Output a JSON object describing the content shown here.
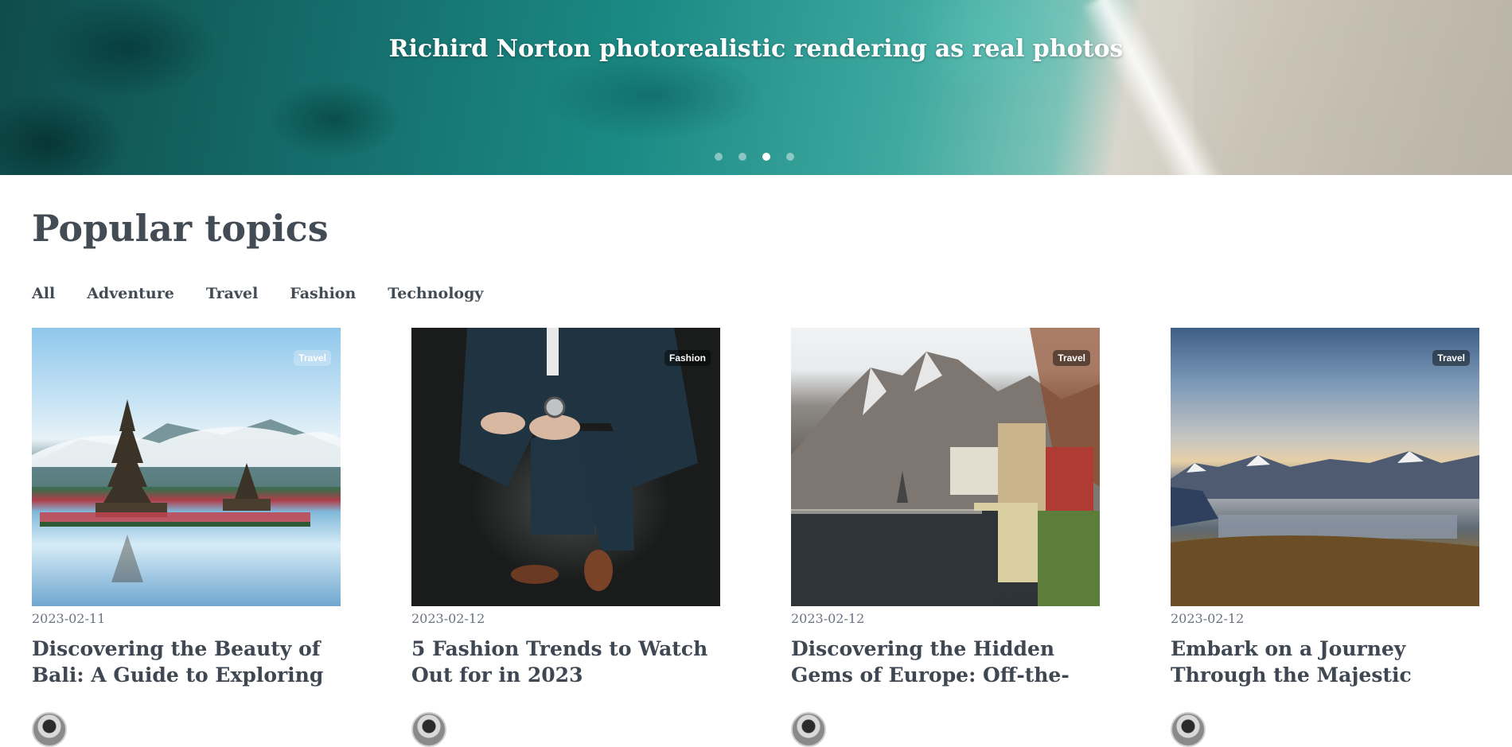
{
  "hero": {
    "title": "Richird Norton photorealistic rendering as real photos",
    "slide_count": 4,
    "active_slide": 3
  },
  "section": {
    "title": "Popular topics",
    "tabs": [
      "All",
      "Adventure",
      "Travel",
      "Fashion",
      "Technology"
    ]
  },
  "posts": [
    {
      "badge": "Travel",
      "date": "2023-02-11",
      "title": "Discovering the Beauty of Bali: A Guide to Exploring the..."
    },
    {
      "badge": "Fashion",
      "date": "2023-02-12",
      "title": "5 Fashion Trends to Watch Out for in 2023"
    },
    {
      "badge": "Travel",
      "date": "2023-02-12",
      "title": "Discovering the Hidden Gems of Europe: Off-the-Beaten-..."
    },
    {
      "badge": "Travel",
      "date": "2023-02-12",
      "title": "Embark on a Journey Through the Majestic Landscapes of..."
    }
  ]
}
